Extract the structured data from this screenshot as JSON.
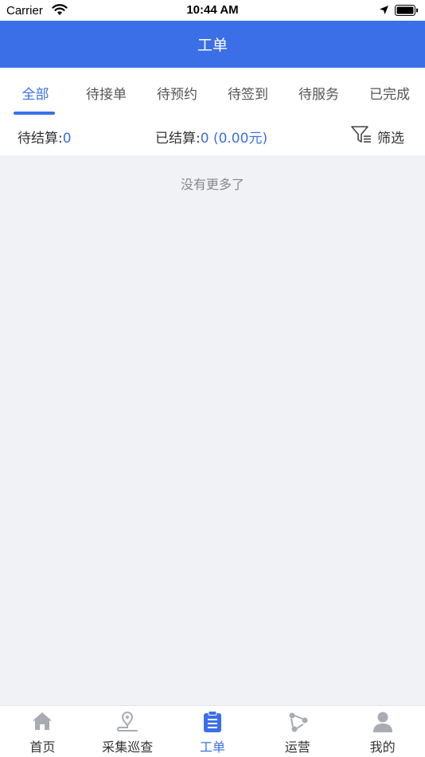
{
  "status_bar": {
    "carrier": "Carrier",
    "time": "10:44 AM"
  },
  "header": {
    "title": "工单"
  },
  "tabs": [
    {
      "label": "全部",
      "active": true
    },
    {
      "label": "待接单",
      "active": false
    },
    {
      "label": "待预约",
      "active": false
    },
    {
      "label": "待签到",
      "active": false
    },
    {
      "label": "待服务",
      "active": false
    },
    {
      "label": "已完成",
      "active": false
    }
  ],
  "summary": {
    "pending_label": "待结算:",
    "pending_value": "0",
    "settled_label": "已结算:",
    "settled_value": "0 (0.00元)",
    "filter_label": "筛选"
  },
  "content": {
    "empty_message": "没有更多了"
  },
  "tabbar": {
    "items": [
      {
        "label": "首页",
        "icon": "home-icon",
        "active": false
      },
      {
        "label": "采集巡查",
        "icon": "location-pin-icon",
        "active": false
      },
      {
        "label": "工单",
        "icon": "clipboard-icon",
        "active": true
      },
      {
        "label": "运营",
        "icon": "share-nodes-icon",
        "active": false
      },
      {
        "label": "我的",
        "icon": "user-icon",
        "active": false
      }
    ]
  },
  "colors": {
    "accent": "#3b6fe8",
    "background": "#f0f2f6",
    "inactive_icon": "#a8abb2"
  }
}
